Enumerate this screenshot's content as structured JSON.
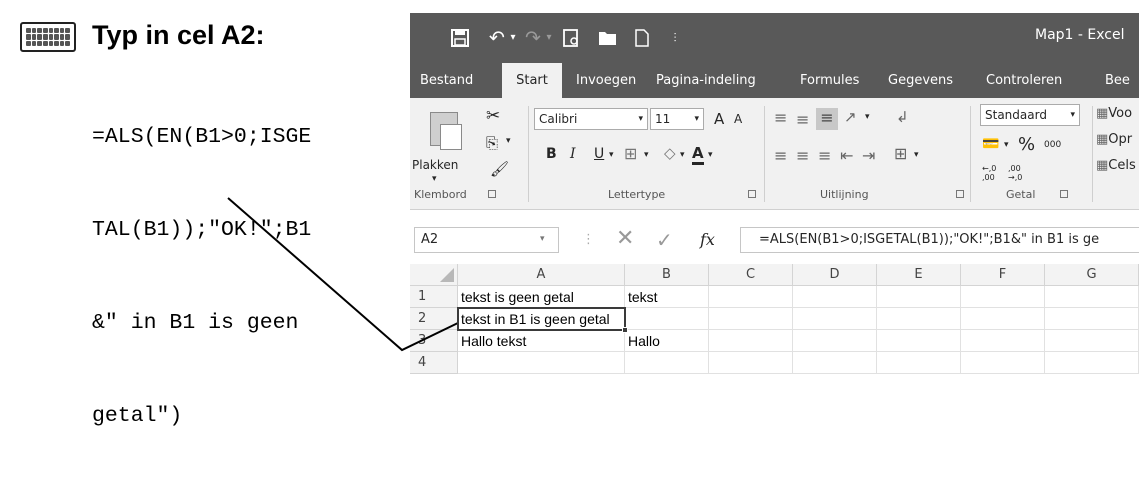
{
  "instruction": {
    "title": "Typ in cel A2:",
    "code_lines": [
      "=ALS(EN(B1>0;ISGE",
      "TAL(B1));\"OK!\";B1",
      "&\" in B1 is geen",
      "getal\")"
    ]
  },
  "window": {
    "title": "Map1  -  Excel"
  },
  "tabs": [
    "Bestand",
    "Start",
    "Invoegen",
    "Pagina-indeling",
    "Formules",
    "Gegevens",
    "Controleren",
    "Bee"
  ],
  "ribbon": {
    "clipboard": {
      "paste_label": "Plakken",
      "group_label": "Klembord"
    },
    "font": {
      "font_name": "Calibri",
      "font_size": "11",
      "group_label": "Lettertype",
      "bold": "B",
      "italic": "I",
      "underline": "U",
      "grow": "A",
      "shrink": "A",
      "font_color": "A"
    },
    "alignment": {
      "group_label": "Uitlijning"
    },
    "number": {
      "format": "Standaard",
      "percent": "%",
      "thousands": "000",
      "inc_decimal": "←,0 ,00",
      "dec_decimal": ",00 →,0",
      "group_label": "Getal"
    },
    "styles": {
      "items": [
        "Voo",
        "Opr",
        "Cels"
      ]
    }
  },
  "formula_bar": {
    "name_box": "A2",
    "fx": "fx",
    "formula": "=ALS(EN(B1>0;ISGETAL(B1));\"OK!\";B1&\" in B1 is ge"
  },
  "grid": {
    "columns": [
      "A",
      "B",
      "C",
      "D",
      "E",
      "F",
      "G"
    ],
    "rows": [
      {
        "num": "1",
        "cells": [
          "tekst is geen getal",
          "tekst"
        ]
      },
      {
        "num": "2",
        "cells": [
          "tekst in B1 is geen getal",
          ""
        ]
      },
      {
        "num": "3",
        "cells": [
          "Hallo tekst",
          "Hallo"
        ]
      },
      {
        "num": "4",
        "cells": [
          "",
          ""
        ]
      }
    ]
  }
}
